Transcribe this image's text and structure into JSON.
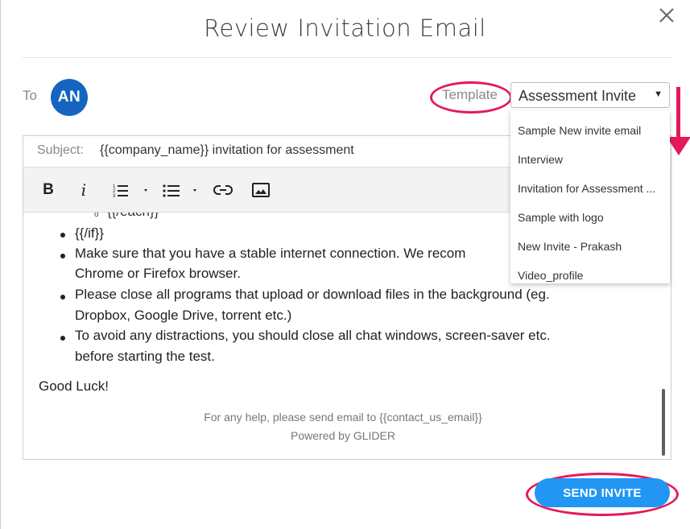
{
  "dialog": {
    "title": "Review Invitation Email"
  },
  "recipient": {
    "label": "To",
    "initials": "AN",
    "avatar_color": "#1565c0"
  },
  "template": {
    "label": "Template",
    "selected": "Assessment Invite",
    "options": [
      "Sample New invite email",
      "Interview",
      "Invitation for Assessment ...",
      "Sample with logo",
      "New Invite - Prakash",
      "Video_profile"
    ]
  },
  "subject": {
    "label": "Subject:",
    "value": "{{company_name}} invitation for assessment"
  },
  "toolbar": {
    "bold": "B",
    "italic": "i",
    "items": [
      "bold-icon",
      "italic-icon",
      "ordered-list-icon",
      "bullet-list-icon",
      "link-icon",
      "image-icon"
    ]
  },
  "body": {
    "truncated_line": "{{/each}}",
    "bullets": [
      "{{/if}}",
      "Make sure that you have a stable internet connection. We recom",
      "Chrome or Firefox browser.",
      "Please close all programs that upload or download files in the background (eg.",
      "Dropbox, Google Drive, torrent etc.)",
      "To avoid any distractions, you should close all chat windows, screen-saver etc.",
      "before starting the test."
    ],
    "closing": "Good Luck!",
    "footer_help": "For any help, please send email to {{contact_us_email}}",
    "footer_powered": "Powered by GLIDER"
  },
  "actions": {
    "send": "SEND INVITE"
  },
  "colors": {
    "accent": "#2196f3",
    "highlight": "#e5195a",
    "avatar": "#1565c0"
  }
}
